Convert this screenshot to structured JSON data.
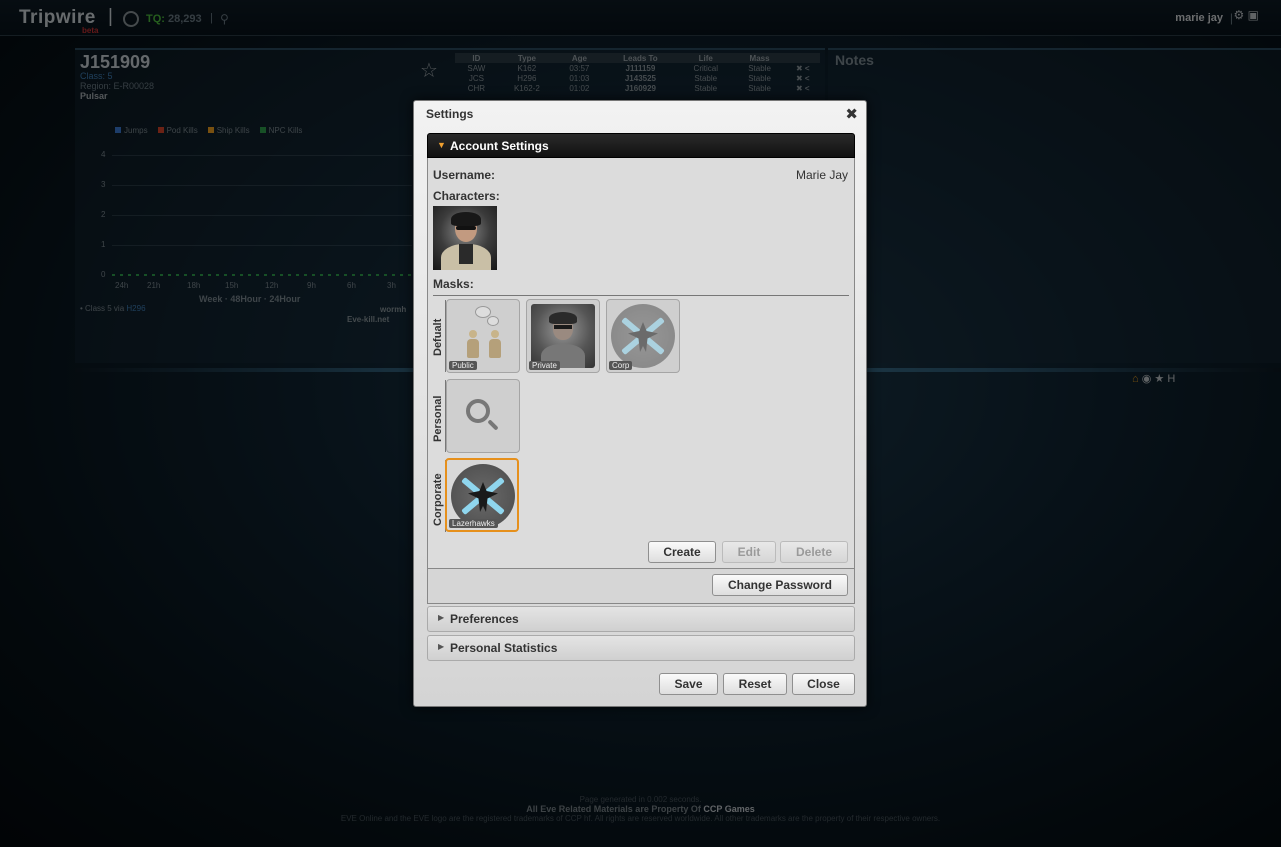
{
  "app": {
    "logo": "Tripwire",
    "logo_badge": "beta",
    "logo_separator": "|",
    "tq_label": "TQ:",
    "tq_count": "28,293",
    "tq_sep": "|",
    "username": "marie jay",
    "user_sep": "|"
  },
  "system": {
    "name": "J151909",
    "class": "Class: 5",
    "region": "Region: E-R00028",
    "effect": "Pulsar"
  },
  "activity_chart": {
    "legend": [
      {
        "label": "Jumps",
        "color": "#3a7bd5"
      },
      {
        "label": "Pod Kills",
        "color": "#d9452b"
      },
      {
        "label": "Ship Kills",
        "color": "#f0a020"
      },
      {
        "label": "NPC Kills",
        "color": "#2fa14c"
      }
    ],
    "y_ticks": [
      "4",
      "3",
      "2",
      "1",
      "0"
    ],
    "x_ticks": [
      "24h",
      "21h",
      "18h",
      "15h",
      "12h",
      "9h",
      "6h",
      "3h"
    ],
    "range_label": "Week · 48Hour · 24Hour",
    "via_prefix": "• Class 5 via",
    "via_link": "H296",
    "link1": "wormh",
    "link2": "Eve-kill.net"
  },
  "signatures": {
    "headers": [
      "ID",
      "Type",
      "Age",
      "Leads To",
      "Life",
      "Mass"
    ],
    "rows": [
      {
        "id": "SAW",
        "type": "K162",
        "age": "03:57",
        "leads": "J111159",
        "life": "Critical",
        "mass": "Stable"
      },
      {
        "id": "JCS",
        "type": "H296",
        "age": "01:03",
        "leads": "J143525",
        "life": "Stable",
        "mass": "Stable"
      },
      {
        "id": "CHR",
        "type": "K162-2",
        "age": "01:02",
        "leads": "J160929",
        "life": "Stable",
        "mass": "Stable"
      }
    ]
  },
  "notes_title": "Notes",
  "footer": {
    "line1": "Page generated in 0.002 seconds.",
    "line2_prefix": "All Eve Related Materials are Property Of",
    "line2_brand": "CCP Games",
    "line3": "EVE Online and the EVE logo are the registered trademarks of CCP hf. All rights are reserved worldwide. All other trademarks are the property of their respective owners."
  },
  "dialog": {
    "title": "Settings",
    "close_glyph": "✖",
    "account": {
      "header": "Account Settings",
      "username_label": "Username:",
      "username_value": "Marie Jay",
      "characters_label": "Characters:",
      "masks_label": "Masks:",
      "groups": {
        "default": "Defualt",
        "personal": "Personal",
        "corporate": "Corporate"
      },
      "masks": {
        "public": "Public",
        "private": "Private",
        "corp": "Corp",
        "lazerhawks": "Lazerhawks"
      },
      "buttons": {
        "create": "Create",
        "edit": "Edit",
        "delete": "Delete",
        "change_password": "Change Password"
      }
    },
    "preferences": "Preferences",
    "personal_statistics": "Personal Statistics",
    "footer_buttons": {
      "save": "Save",
      "reset": "Reset",
      "close": "Close"
    }
  }
}
